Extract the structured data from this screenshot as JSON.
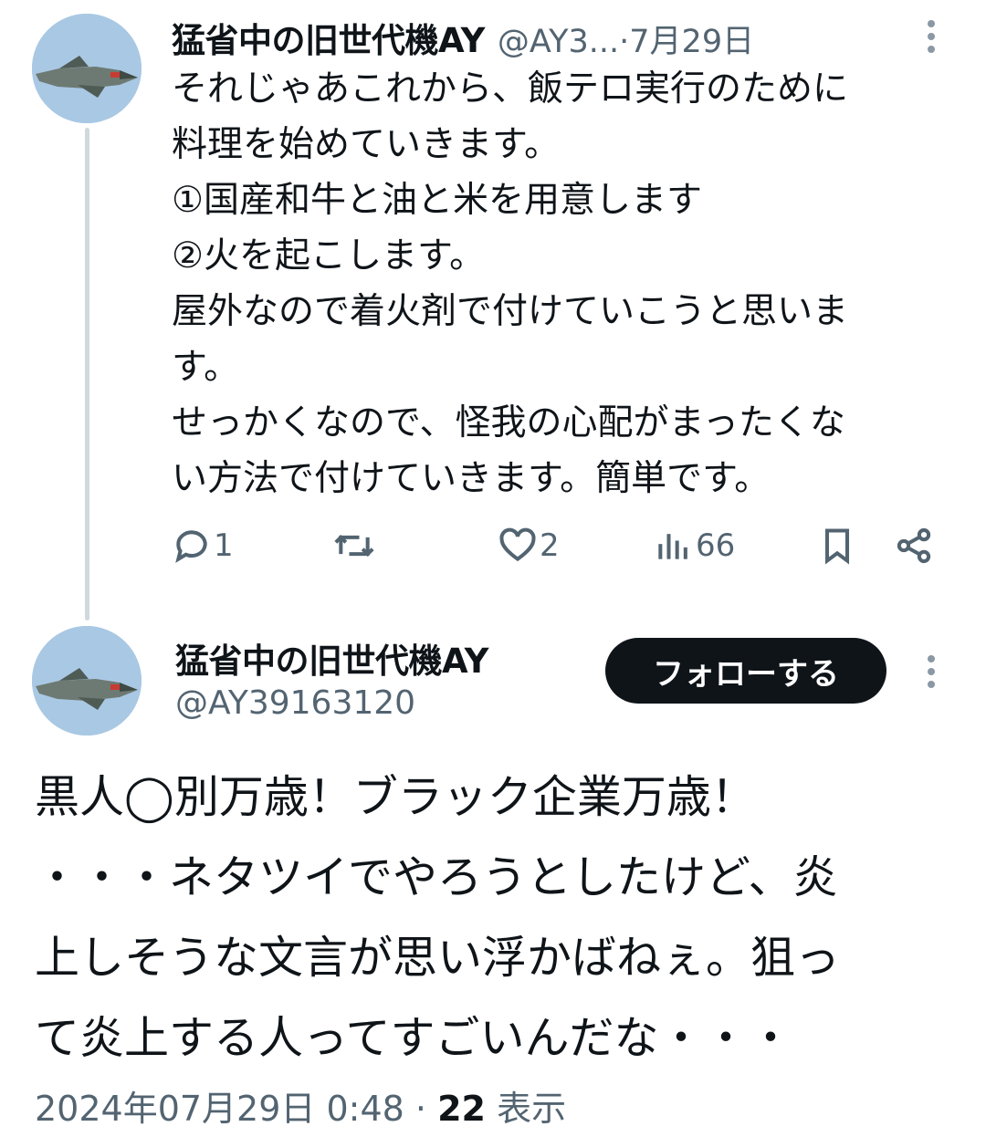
{
  "thread_tweet": {
    "display_name": "猛省中の旧世代機AY",
    "handle": "@AY3...",
    "separator": " · ",
    "date": "7月29日",
    "text": "それじゃあこれから、飯テロ実行のために\n料理を始めていきます。\n①国産和牛と油と米を用意します\n②火を起こします。\n屋外なので着火剤で付けていこうと思いま\nす。\nせっかくなので、怪我の心配がまったくな\nい方法で付けていきます。簡単です。",
    "actions": {
      "reply_count": "1",
      "retweet_count": "",
      "like_count": "2",
      "views_count": "66"
    },
    "icons": [
      "more-vertical-icon",
      "reply-icon",
      "retweet-icon",
      "like-icon",
      "views-icon",
      "bookmark-icon",
      "share-icon"
    ]
  },
  "main_tweet": {
    "display_name": "猛省中の旧世代機AY",
    "handle": "@AY39163120",
    "follow_label": "フォローする",
    "text": "黒人◯別万歳！ブラック企業万歳！\n・・・ネタツイでやろうとしたけど、炎\n上しそうな文言が思い浮かばねぇ。狙っ\nて炎上する人ってすごいんだな・・・",
    "timestamp": "2024年07月29日 0:48",
    "separator": " · ",
    "view_count": "22",
    "view_label": "表示"
  },
  "colors": {
    "text": "#0f1419",
    "muted": "#536471",
    "thread_line": "#cfd9de",
    "follow_bg": "#0f1419",
    "follow_text": "#ffffff"
  }
}
